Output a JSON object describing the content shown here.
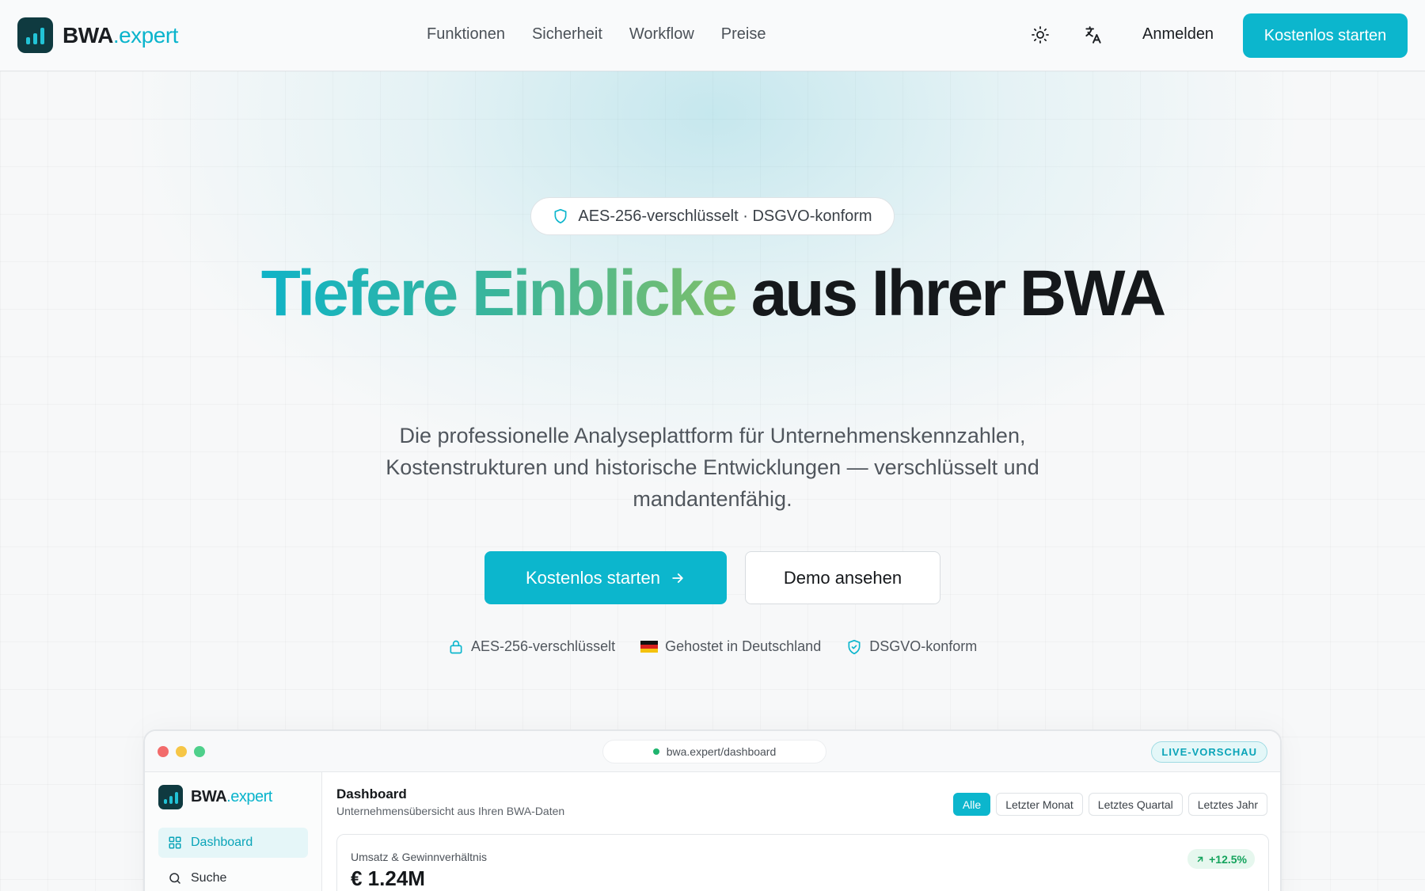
{
  "header": {
    "logo_main": "BWA",
    "logo_accent": ".expert",
    "nav": [
      "Funktionen",
      "Sicherheit",
      "Workflow",
      "Preise"
    ],
    "login_label": "Anmelden",
    "cta_label": "Kostenlos starten"
  },
  "hero": {
    "badge": "AES-256-verschlüsselt · DSGVO-konform",
    "title_accent": "Tiefere Einblicke",
    "title_rest": " aus Ihrer BWA",
    "subtitle": "Die professionelle Analyseplattform für Unternehmenskennzahlen, Kostenstrukturen und historische Entwicklungen — verschlüsselt und mandantenfähig.",
    "cta_primary": "Kostenlos starten",
    "cta_secondary": "Demo ansehen",
    "trust": [
      "AES-256-verschlüsselt",
      "Gehostet in Deutschland",
      "DSGVO-konform"
    ]
  },
  "preview": {
    "url": "bwa.expert/dashboard",
    "live_label": "LIVE-VORSCHAU",
    "sidebar_logo_main": "BWA",
    "sidebar_logo_accent": ".expert",
    "sidebar_items": [
      "Dashboard",
      "Suche"
    ],
    "title": "Dashboard",
    "subtitle": "Unternehmensübersicht aus Ihren BWA-Daten",
    "filters": [
      "Alle",
      "Letzter Monat",
      "Letztes Quartal",
      "Letztes Jahr"
    ],
    "card": {
      "label": "Umsatz & Gewinnverhältnis",
      "value": "€ 1.24M",
      "delta": "+12.5%"
    }
  },
  "colors": {
    "accent": "#0cb6cd",
    "logo_bg": "#0f3a40",
    "positive": "#14a35c"
  }
}
